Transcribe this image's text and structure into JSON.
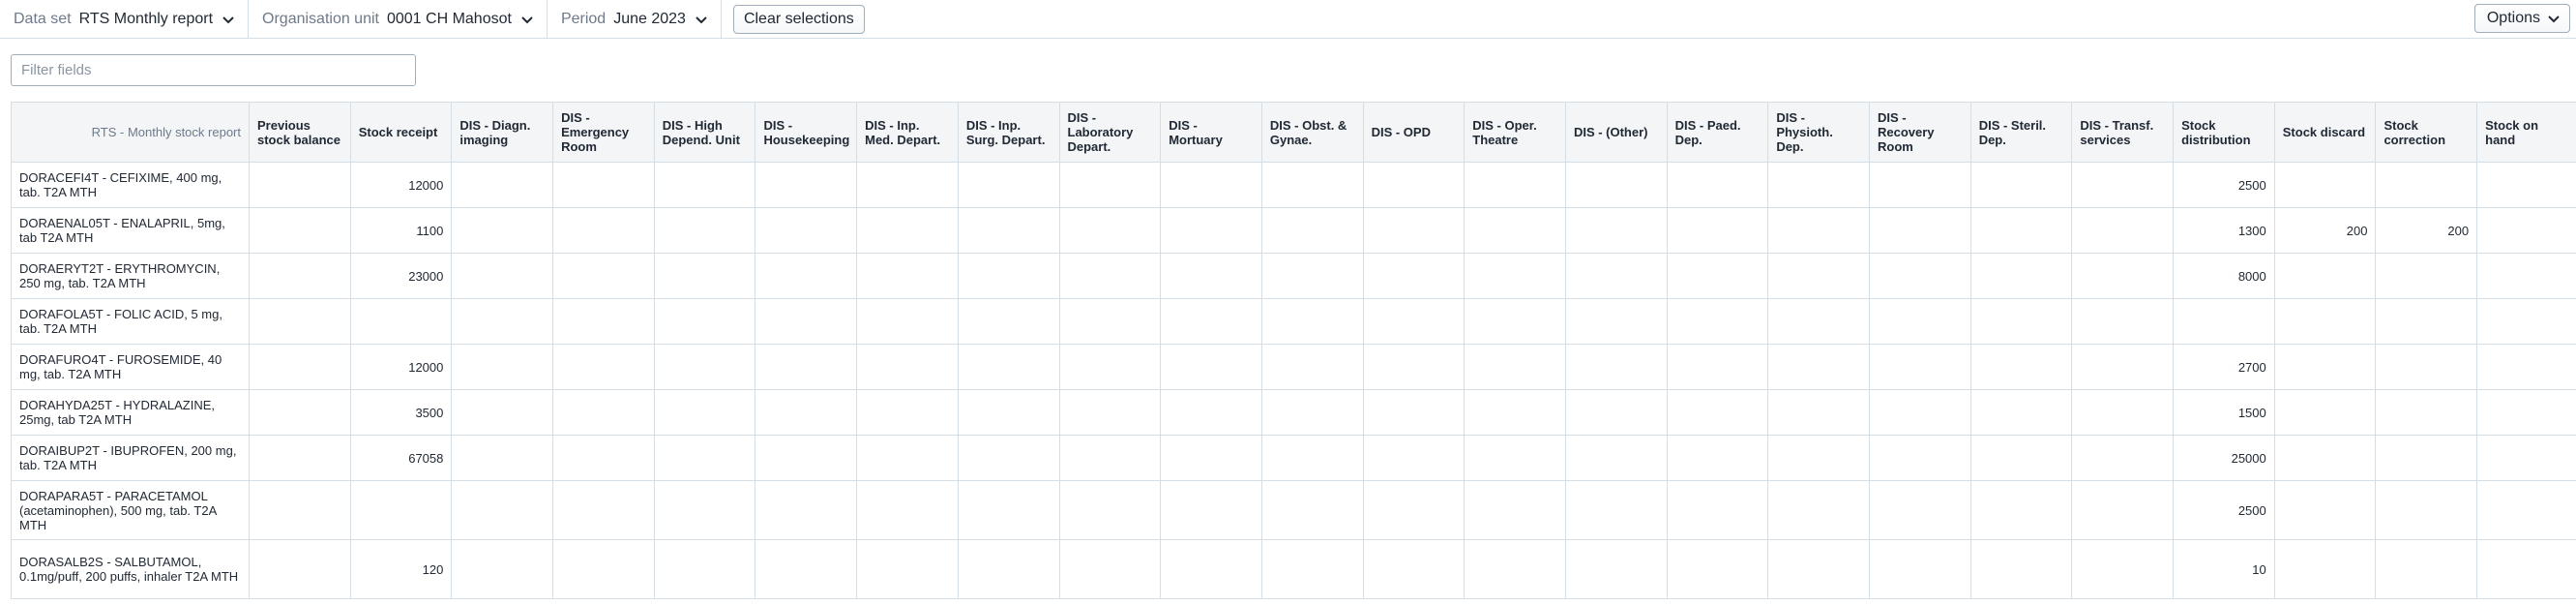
{
  "toolbar": {
    "dataset": {
      "label": "Data set",
      "value": "RTS Monthly report"
    },
    "orgunit": {
      "label": "Organisation unit",
      "value": "0001 CH Mahosot"
    },
    "period": {
      "label": "Period",
      "value": "June 2023"
    },
    "clear_label": "Clear selections",
    "options_label": "Options"
  },
  "filter": {
    "placeholder": "Filter fields"
  },
  "table": {
    "corner": "RTS - Monthly stock report",
    "columns": [
      "Previous stock balance",
      "Stock receipt",
      "DIS - Diagn. imaging",
      "DIS - Emergency Room",
      "DIS - High Depend. Unit",
      "DIS - Housekeeping",
      "DIS - Inp. Med. Depart.",
      "DIS - Inp. Surg. Depart.",
      "DIS - Laboratory Depart.",
      "DIS - Mortuary",
      "DIS - Obst. & Gynae.",
      "DIS - OPD",
      "DIS - Oper. Theatre",
      "DIS - (Other)",
      "DIS - Paed. Dep.",
      "DIS - Physioth. Dep.",
      "DIS - Recovery Room",
      "DIS - Steril. Dep.",
      "DIS - Transf. services",
      "Stock distribution",
      "Stock discard",
      "Stock correction",
      "Stock on hand"
    ],
    "rows": [
      {
        "label": "DORACEFI4T - CEFIXIME, 400 mg, tab. T2A MTH",
        "values": [
          "",
          "12000",
          "",
          "",
          "",
          "",
          "",
          "",
          "",
          "",
          "",
          "",
          "",
          "",
          "",
          "",
          "",
          "",
          "",
          "2500",
          "",
          "",
          ""
        ]
      },
      {
        "label": "DORAENAL05T - ENALAPRIL, 5mg, tab T2A MTH",
        "values": [
          "",
          "1100",
          "",
          "",
          "",
          "",
          "",
          "",
          "",
          "",
          "",
          "",
          "",
          "",
          "",
          "",
          "",
          "",
          "",
          "1300",
          "200",
          "200",
          ""
        ]
      },
      {
        "label": "DORAERYT2T - ERYTHROMYCIN, 250 mg, tab. T2A MTH",
        "values": [
          "",
          "23000",
          "",
          "",
          "",
          "",
          "",
          "",
          "",
          "",
          "",
          "",
          "",
          "",
          "",
          "",
          "",
          "",
          "",
          "8000",
          "",
          "",
          ""
        ]
      },
      {
        "label": "DORAFOLA5T - FOLIC ACID, 5 mg, tab. T2A MTH",
        "values": [
          "",
          "",
          "",
          "",
          "",
          "",
          "",
          "",
          "",
          "",
          "",
          "",
          "",
          "",
          "",
          "",
          "",
          "",
          "",
          "",
          "",
          "",
          ""
        ]
      },
      {
        "label": "DORAFURO4T - FUROSEMIDE, 40 mg, tab. T2A MTH",
        "values": [
          "",
          "12000",
          "",
          "",
          "",
          "",
          "",
          "",
          "",
          "",
          "",
          "",
          "",
          "",
          "",
          "",
          "",
          "",
          "",
          "2700",
          "",
          "",
          ""
        ]
      },
      {
        "label": "DORAHYDA25T - HYDRALAZINE, 25mg, tab T2A MTH",
        "values": [
          "",
          "3500",
          "",
          "",
          "",
          "",
          "",
          "",
          "",
          "",
          "",
          "",
          "",
          "",
          "",
          "",
          "",
          "",
          "",
          "1500",
          "",
          "",
          ""
        ]
      },
      {
        "label": "DORAIBUP2T - IBUPROFEN, 200 mg, tab. T2A MTH",
        "values": [
          "",
          "67058",
          "",
          "",
          "",
          "",
          "",
          "",
          "",
          "",
          "",
          "",
          "",
          "",
          "",
          "",
          "",
          "",
          "",
          "25000",
          "",
          "",
          ""
        ]
      },
      {
        "label": "DORAPARA5T - PARACETAMOL (acetaminophen), 500 mg, tab. T2A MTH",
        "values": [
          "",
          "",
          "",
          "",
          "",
          "",
          "",
          "",
          "",
          "",
          "",
          "",
          "",
          "",
          "",
          "",
          "",
          "",
          "",
          "2500",
          "",
          "",
          ""
        ]
      },
      {
        "label": "DORASALB2S - SALBUTAMOL, 0.1mg/puff, 200 puffs, inhaler T2A MTH",
        "values": [
          "",
          "120",
          "",
          "",
          "",
          "",
          "",
          "",
          "",
          "",
          "",
          "",
          "",
          "",
          "",
          "",
          "",
          "",
          "",
          "10",
          "",
          "",
          ""
        ]
      }
    ]
  }
}
